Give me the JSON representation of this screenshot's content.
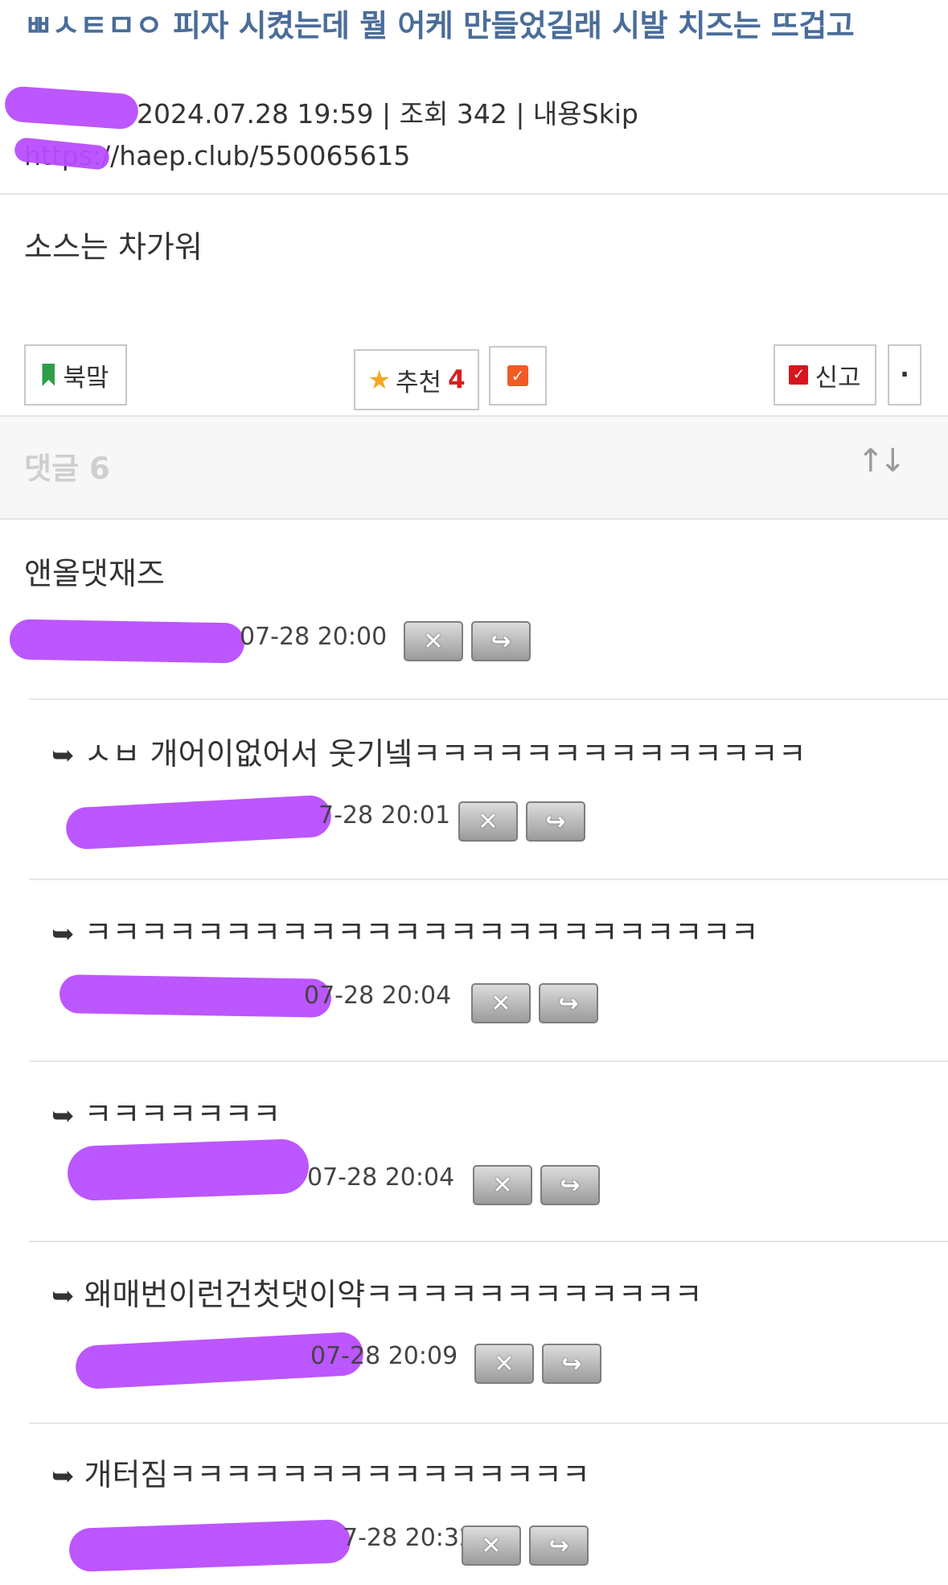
{
  "post": {
    "title": "ㅃㅅㅌㅁㅇ 피자 시켰는데 뭘 어케 만들었길래 시발 치즈는 뜨겁고",
    "meta": "2024.07.28 19:59 | 조회 342 | 내용Skip",
    "url": "https://haep.club/550065615",
    "body": "소스는 차가워"
  },
  "actions": {
    "bookmark_label": "북맠",
    "recommend_label": "추천",
    "recommend_count": "4",
    "report_label": "신고",
    "more_label": "·"
  },
  "comments_header": {
    "label": "댓글 6",
    "sort_icon": "↑↓"
  },
  "comments": [
    {
      "text": "앤올댓재즈",
      "time": "07-28 20:00"
    },
    {
      "text": "ㅅㅂ 개어이없어서 웃기넼ㅋㅋㅋㅋㅋㅋㅋㅋㅋㅋㅋㅋㅋㅋ",
      "time": "7-28 20:01"
    },
    {
      "text": "ㅋㅋㅋㅋㅋㅋㅋㅋㅋㅋㅋㅋㅋㅋㅋㅋㅋㅋㅋㅋㅋㅋㅋㅋ",
      "time": "07-28 20:04"
    },
    {
      "text": "ㅋㅋㅋㅋㅋㅋㅋ",
      "time": "07-28 20:04"
    },
    {
      "text": "왜매번이런건첫댓이약ㅋㅋㅋㅋㅋㅋㅋㅋㅋㅋㅋㅋ",
      "time": "07-28 20:09"
    },
    {
      "text": "개터짐ㅋㅋㅋㅋㅋㅋㅋㅋㅋㅋㅋㅋㅋㅋㅋ",
      "time": "7-28 20:32"
    }
  ],
  "icons": {
    "reply_arrow": "➥",
    "delete": "✕",
    "reply": "↪"
  },
  "colors": {
    "title": "#4a6d9a",
    "redaction": "#b84dff",
    "accent_red": "#d81e1e"
  }
}
